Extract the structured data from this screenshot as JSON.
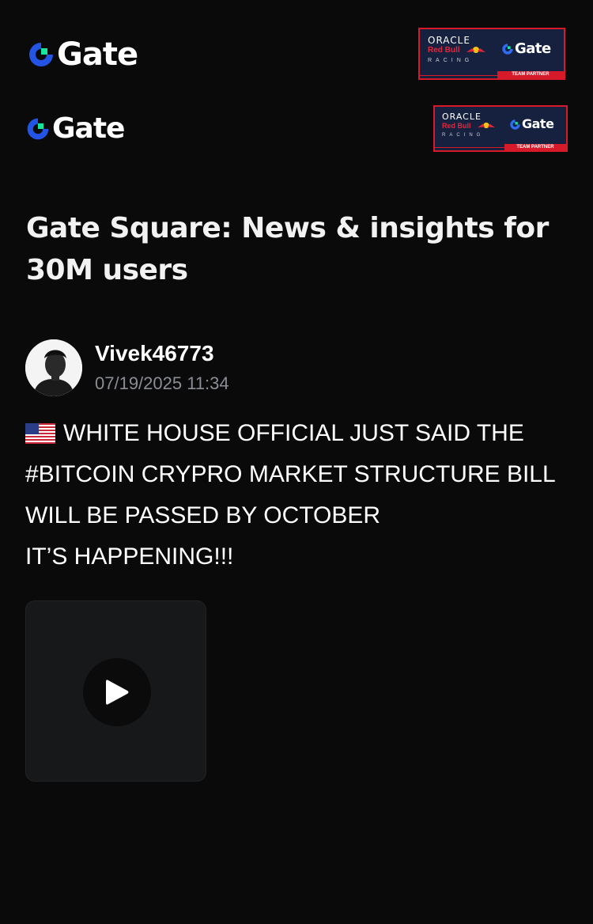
{
  "header": {
    "logo_text": "Gate",
    "partner_badge": {
      "line1": "ORACLE",
      "line2": "Red Bull",
      "line3": "RACING",
      "partner_logo_text": "Gate",
      "ribbon": "TEAM PARTNER"
    }
  },
  "headline": "Gate Square: News & insights for 30M users",
  "post": {
    "author": "Vivek46773",
    "timestamp": "07/19/2025 11:34",
    "flag_icon": "us-flag-emoji",
    "lines": [
      "WHITE HOUSE OFFICIAL JUST SAID THE",
      "#BITCOIN CRYPRO MARKET STRUCTURE BILL",
      "WILL BE PASSED BY OCTOBER",
      "IT’S HAPPENING!!!"
    ],
    "media": {
      "type": "video",
      "icon": "play-icon"
    }
  },
  "colors": {
    "background": "#0a0a0b",
    "brand_blue": "#2354e6",
    "brand_green": "#17e6a1",
    "partner_navy": "#15213f",
    "partner_red": "#d71a2a",
    "muted_text": "#8a8d93"
  }
}
